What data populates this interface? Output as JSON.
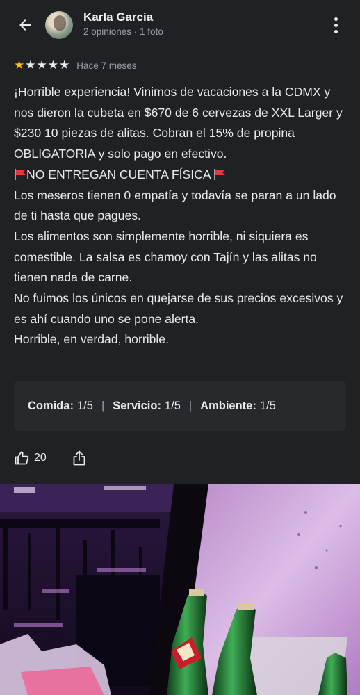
{
  "header": {
    "user_name": "Karla Garcia",
    "user_meta": "2 opiniones · 1 foto"
  },
  "review": {
    "rating": 1,
    "max_rating": 5,
    "time_ago": "Hace 7 meses",
    "paragraphs": {
      "p1": "¡Horrible experiencia! Vinimos de vacaciones a la CDMX y nos dieron la cubeta en $670 de 6 cervezas de XXL Larger y $230 10 piezas de alitas. Cobran el 15% de propina OBLIGATORIA y solo pago en efectivo.",
      "p2": "NO ENTREGAN CUENTA FÍSICA",
      "p3": "Los meseros tienen 0 empatía y todavía se paran a un lado de ti hasta que pagues.",
      "p4": "Los alimentos son simplemente horrible, ni siquiera es comestible. La salsa es chamoy con Tajín y las alitas no tienen nada de carne.",
      "p5": "No fuimos los únicos en quejarse de sus precios excesivos y es ahí cuando uno se pone alerta.",
      "p6": "Horrible, en verdad, horrible."
    }
  },
  "summary": {
    "food_label": "Comida:",
    "food_value": "1/5",
    "service_label": "Servicio:",
    "service_value": "1/5",
    "ambience_label": "Ambiente:",
    "ambience_value": "1/5"
  },
  "actions": {
    "like_count": "20"
  },
  "icons": {
    "back": "arrow-back-icon",
    "more": "more-vert-icon",
    "like": "thumb-up-icon",
    "share": "share-icon",
    "flag": "red-flag-icon"
  },
  "colors": {
    "star_filled": "#fbbc04",
    "background": "#202124",
    "flag": "#e53935"
  }
}
